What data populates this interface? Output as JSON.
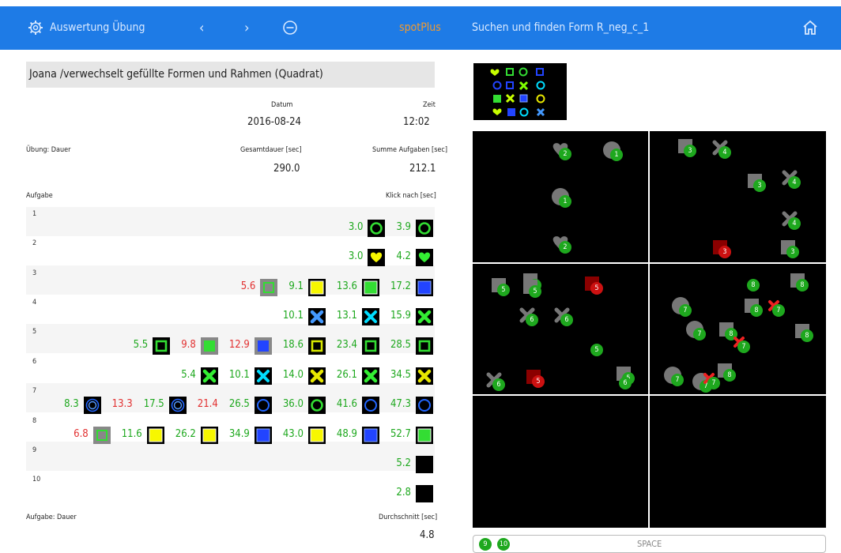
{
  "colors": {
    "nav": "#1e7be6",
    "accent": "#f29a2e",
    "green": "#1ea81e",
    "red": "#e23030"
  },
  "nav": {
    "settings_icon": "gear-icon",
    "title": "Auswertung Übung",
    "prev_icon": "chevron-left-icon",
    "next_icon": "chevron-right-icon",
    "minus_icon": "minus-circle-icon",
    "brand": "spotPlus",
    "exercise": "Suchen und finden Form R_neg_c_1",
    "home_icon": "home-icon"
  },
  "summary": {
    "title": "Joana /verwechselt gefüllte Formen und Rahmen (Quadrat)",
    "date_label": "Datum",
    "date": "2016-08-24",
    "time_label": "Zeit",
    "time": "12:02",
    "exercise_duration_label": "Übung: Dauer",
    "total_label": "Gesamtdauer [sec]",
    "total": "290.0",
    "sum_label": "Summe Aufgaben [sec]",
    "sum": "212.1",
    "tasks_label": "Aufgabe",
    "click_label": "Klick nach [sec]",
    "task_duration_label": "Aufgabe: Dauer",
    "avg_label": "Durchschnitt [sec]",
    "avg": "4.8"
  },
  "tasks": [
    {
      "n": "1",
      "clicks": [
        {
          "t": "3.0",
          "c": "g",
          "s": "ring-green"
        },
        {
          "t": "3.9",
          "c": "g",
          "s": "ring-green"
        }
      ]
    },
    {
      "n": "2",
      "clicks": [
        {
          "t": "3.0",
          "c": "g",
          "s": "heart-yellow"
        },
        {
          "t": "4.2",
          "c": "g",
          "s": "heart-green"
        }
      ]
    },
    {
      "n": "3",
      "clicks": [
        {
          "t": "5.6",
          "c": "r",
          "s": "gray-sq-green"
        },
        {
          "t": "9.1",
          "c": "g",
          "s": "sq-yellow"
        },
        {
          "t": "13.6",
          "c": "g",
          "s": "sq-green"
        },
        {
          "t": "17.2",
          "c": "g",
          "s": "sq-blue"
        }
      ]
    },
    {
      "n": "4",
      "clicks": [
        {
          "t": "10.1",
          "c": "g",
          "s": "x-blue"
        },
        {
          "t": "13.1",
          "c": "g",
          "s": "x-cyan"
        },
        {
          "t": "15.9",
          "c": "g",
          "s": "x-green"
        }
      ]
    },
    {
      "n": "5",
      "clicks": [
        {
          "t": "5.5",
          "c": "g",
          "s": "frame-green"
        },
        {
          "t": "9.8",
          "c": "r",
          "s": "gray-sq-greenfill"
        },
        {
          "t": "12.9",
          "c": "r",
          "s": "gray-sq-blue"
        },
        {
          "t": "18.6",
          "c": "g",
          "s": "frame-yellow"
        },
        {
          "t": "23.4",
          "c": "g",
          "s": "frame-green"
        },
        {
          "t": "28.5",
          "c": "g",
          "s": "frame-green"
        }
      ]
    },
    {
      "n": "6",
      "clicks": [
        {
          "t": "5.4",
          "c": "g",
          "s": "x-green"
        },
        {
          "t": "10.1",
          "c": "g",
          "s": "x-cyan"
        },
        {
          "t": "14.0",
          "c": "g",
          "s": "x-yellow"
        },
        {
          "t": "26.1",
          "c": "g",
          "s": "x-green"
        },
        {
          "t": "34.5",
          "c": "g",
          "s": "x-yellow"
        }
      ]
    },
    {
      "n": "7",
      "clicks": [
        {
          "t": "8.3",
          "c": "g",
          "s": "ring-blue2"
        },
        {
          "t": "13.3",
          "c": "r",
          "s": ""
        },
        {
          "t": "17.5",
          "c": "g",
          "s": "ring-blue2"
        },
        {
          "t": "21.4",
          "c": "r",
          "s": ""
        },
        {
          "t": "26.5",
          "c": "g",
          "s": "ring-blue"
        },
        {
          "t": "36.0",
          "c": "g",
          "s": "ring-green"
        },
        {
          "t": "41.6",
          "c": "g",
          "s": "ring-blue"
        },
        {
          "t": "47.3",
          "c": "g",
          "s": "ring-blue"
        }
      ]
    },
    {
      "n": "8",
      "clicks": [
        {
          "t": "6.8",
          "c": "r",
          "s": "gray-sq-green"
        },
        {
          "t": "11.6",
          "c": "g",
          "s": "sq-yellow"
        },
        {
          "t": "26.2",
          "c": "g",
          "s": "sq-yellow"
        },
        {
          "t": "34.9",
          "c": "g",
          "s": "sq-blue"
        },
        {
          "t": "43.0",
          "c": "g",
          "s": "sq-yellow"
        },
        {
          "t": "48.9",
          "c": "g",
          "s": "sq-blue"
        },
        {
          "t": "52.7",
          "c": "g",
          "s": "sq-green"
        }
      ]
    },
    {
      "n": "9",
      "clicks": [
        {
          "t": "5.2",
          "c": "g",
          "s": "black"
        }
      ]
    },
    {
      "n": "10",
      "clicks": [
        {
          "t": "2.8",
          "c": "g",
          "s": "black"
        }
      ]
    }
  ],
  "grid_markers": [
    {
      "label": "2"
    },
    {
      "label": "1"
    },
    {
      "label": "1"
    },
    {
      "label": "2"
    },
    {
      "label": "3"
    },
    {
      "label": "4"
    },
    {
      "label": "3"
    },
    {
      "label": "4"
    },
    {
      "label": "4"
    },
    {
      "label": "3"
    },
    {
      "label": "3"
    },
    {
      "label": "5"
    },
    {
      "label": "6"
    },
    {
      "label": "5"
    },
    {
      "label": "5"
    },
    {
      "label": "6"
    },
    {
      "label": "6"
    },
    {
      "label": "5"
    },
    {
      "label": "5"
    },
    {
      "label": "6"
    },
    {
      "label": "5"
    },
    {
      "label": "6"
    },
    {
      "label": "8"
    },
    {
      "label": "8"
    },
    {
      "label": "7"
    },
    {
      "label": "8"
    },
    {
      "label": "7"
    },
    {
      "label": "7"
    },
    {
      "label": "8"
    },
    {
      "label": "8"
    },
    {
      "label": "7"
    },
    {
      "label": "7"
    },
    {
      "label": "7"
    },
    {
      "label": "7"
    },
    {
      "label": "8"
    }
  ],
  "bottom": {
    "chip1": "9",
    "chip2": "10",
    "space": "SPACE"
  }
}
